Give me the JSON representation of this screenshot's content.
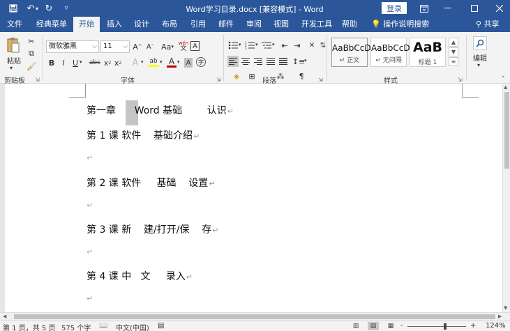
{
  "window": {
    "title": "Word学习目录.docx [兼容模式]  -  Word",
    "login_label": "登录",
    "ribbon_display_icon": "ribbon-display-icon",
    "minimize_icon": "minimize-icon",
    "restore_icon": "restore-icon",
    "close_icon": "close-icon"
  },
  "quick_access": {
    "save_icon": "save-icon",
    "undo_icon": "undo-icon",
    "redo_icon": "redo-icon",
    "customize_icon": "customize-icon"
  },
  "tabs": [
    {
      "label": "文件"
    },
    {
      "label": "经典菜单"
    },
    {
      "label": "开始",
      "active": true
    },
    {
      "label": "插入"
    },
    {
      "label": "设计"
    },
    {
      "label": "布局"
    },
    {
      "label": "引用"
    },
    {
      "label": "邮件"
    },
    {
      "label": "审阅"
    },
    {
      "label": "视图"
    },
    {
      "label": "开发工具"
    },
    {
      "label": "帮助"
    }
  ],
  "tell_me": {
    "label": "操作说明搜索",
    "icon": "lightbulb-icon"
  },
  "share": {
    "label": "共享",
    "icon": "person-icon"
  },
  "ribbon": {
    "clipboard": {
      "label": "剪贴板",
      "paste_label": "粘贴",
      "icons": [
        "paste-icon",
        "cut-icon",
        "copy-icon",
        "format-painter-icon"
      ]
    },
    "font": {
      "label": "字体",
      "font_name": "微软雅黑",
      "font_size": "11",
      "grow_font": "A",
      "shrink_font": "A",
      "change_case": "Aa",
      "wen": "wén",
      "wen_char": "文",
      "border_a": "A",
      "bold": "B",
      "italic": "I",
      "underline": "U",
      "strikethrough": "abc",
      "subscript": "x",
      "superscript": "x",
      "effects": "A",
      "highlight": "ab",
      "font_color": "A",
      "shade": "A",
      "enclose": "字",
      "font_color_hex": "#c00000",
      "highlight_hex": "#ffff00"
    },
    "paragraph": {
      "label": "段落"
    },
    "styles": {
      "label": "样式",
      "items": [
        {
          "sample": "AaBbCcD",
          "name": "正文"
        },
        {
          "sample": "AaBbCcD",
          "name": "无间隔"
        },
        {
          "sample": "AaB",
          "name": "标题 1"
        }
      ]
    },
    "editing": {
      "label": "编辑",
      "icon": "search-icon"
    }
  },
  "document": {
    "lines": [
      "第一章      Word 基础        认识",
      "第 1 课 软件    基础介绍",
      "",
      "第 2 课 软件     基础    设置",
      "",
      "第 3 课 新    建/打开/保    存",
      "",
      "第 4 课 中   文     录入",
      ""
    ],
    "paragraph_mark": "↵"
  },
  "status": {
    "page": "第 1 页，共 5 页",
    "words": "575 个字",
    "language": "中文(中国)",
    "zoom": "124%",
    "zoom_minus": "-",
    "zoom_plus": "+"
  }
}
